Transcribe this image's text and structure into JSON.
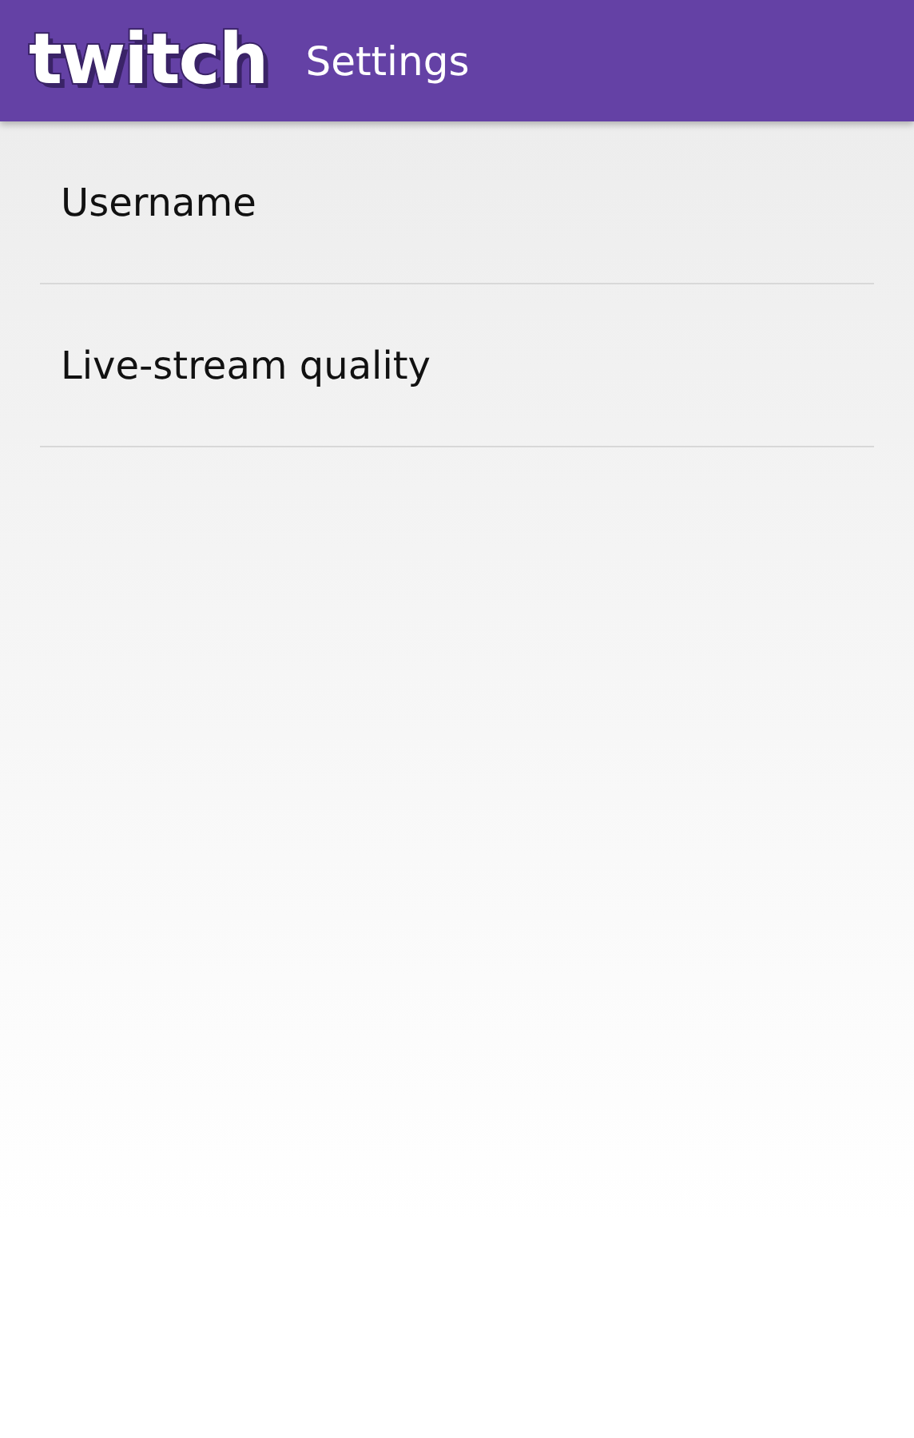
{
  "app_bar": {
    "logo": "twitch",
    "title": "Settings"
  },
  "settings": [
    {
      "label": "Username"
    },
    {
      "label": "Live-stream quality"
    }
  ]
}
